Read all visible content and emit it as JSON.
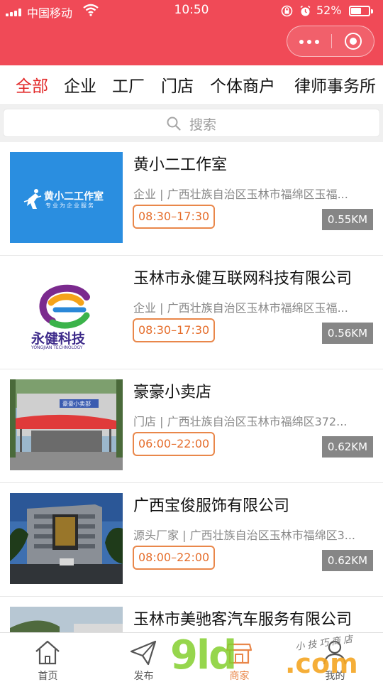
{
  "status_bar": {
    "carrier": "中国移动",
    "time": "10:50",
    "battery_percent": "52%",
    "battery_level": 0.52,
    "icons": [
      "signal-icon",
      "wifi-icon",
      "orientation-lock-icon",
      "alarm-icon",
      "battery-icon"
    ]
  },
  "nav": {
    "bar_color": "#f04a57",
    "capsule_icons": [
      "more-icon",
      "close-miniprogram-icon"
    ]
  },
  "tabs": [
    {
      "label": "全部",
      "active": true
    },
    {
      "label": "企业",
      "active": false
    },
    {
      "label": "工厂",
      "active": false
    },
    {
      "label": "门店",
      "active": false
    },
    {
      "label": "个体商户",
      "active": false
    },
    {
      "label": "律师事务所",
      "active": false
    }
  ],
  "search": {
    "placeholder": "搜索"
  },
  "items": [
    {
      "name": "黄小二工作室",
      "info": "企业 | 广西壮族自治区玉林市福绵区玉福...",
      "hours": "08:30–17:30",
      "distance": "0.55KM",
      "logo_text": "黄小二工作室",
      "logo_subtext": "专业为企业服务"
    },
    {
      "name": "玉林市永健互联网科技有限公司",
      "info": "企业 | 广西壮族自治区玉林市福绵区玉福...",
      "hours": "08:30–17:30",
      "distance": "0.56KM",
      "logo_text": "永健科技",
      "logo_subtext": "YONGJIAN TECHNOLOGY"
    },
    {
      "name": "豪豪小卖店",
      "info": "门店 | 广西壮族自治区玉林市福绵区372...",
      "hours": "06:00–22:00",
      "distance": "0.62KM",
      "logo_text": "豪豪小卖部"
    },
    {
      "name": "广西宝俊服饰有限公司",
      "info": "源头厂家 | 广西壮族自治区玉林市福绵区3...",
      "hours": "08:00–22:00",
      "distance": "0.62KM"
    },
    {
      "name": "玉林市美驰客汽车服务有限公司",
      "info": "",
      "hours": "",
      "distance": ""
    }
  ],
  "tabbar": [
    {
      "label": "首页",
      "icon": "home-icon",
      "active": false
    },
    {
      "label": "发布",
      "icon": "send-icon",
      "active": false
    },
    {
      "label": "商家",
      "icon": "store-icon",
      "active": true
    },
    {
      "label": "我的",
      "icon": "user-icon",
      "active": false
    }
  ],
  "watermark": {
    "big": "9ld",
    "com": ".com",
    "small": "小技巧商店"
  },
  "colors": {
    "accent": "#e22a2a",
    "hours": "#e9874a",
    "distance_bg": "#868686"
  }
}
